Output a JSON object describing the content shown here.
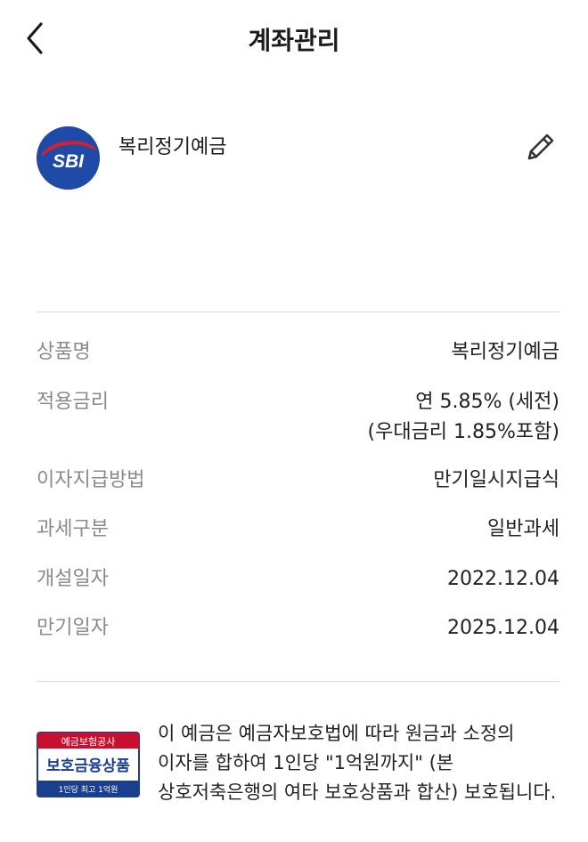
{
  "header": {
    "title": "계좌관리"
  },
  "account": {
    "logo_text": "SBI",
    "name": "복리정기예금"
  },
  "details": [
    {
      "label": "상품명",
      "value": "복리정기예금"
    },
    {
      "label": "적용금리",
      "value": "연 5.85% (세전)",
      "value2": "(우대금리 1.85%포함)"
    },
    {
      "label": "이자지급방법",
      "value": "만기일시지급식"
    },
    {
      "label": "과세구분",
      "value": "일반과세"
    },
    {
      "label": "개설일자",
      "value": "2022.12.04"
    },
    {
      "label": "만기일자",
      "value": "2025.12.04"
    }
  ],
  "notice": {
    "badge_top": "예금보험공사",
    "badge_main": "보호금융상품",
    "badge_bottom": "1인당 최고 1억원",
    "text": "이 예금은 예금자보호법에 따라 원금과 소정의 이자를 합하여 1인당 \"1억원까지\" (본 상호저축은행의 여타 보호상품과 합산) 보호됩니다."
  },
  "colors": {
    "brand_blue": "#1f4aa8",
    "badge_red": "#c8102e",
    "badge_navy": "#1b3f8f",
    "label_gray": "#8a8a8a",
    "divider": "#dcdcdc"
  },
  "icons": {
    "back": "chevron-left-icon",
    "edit": "pencil-icon"
  }
}
